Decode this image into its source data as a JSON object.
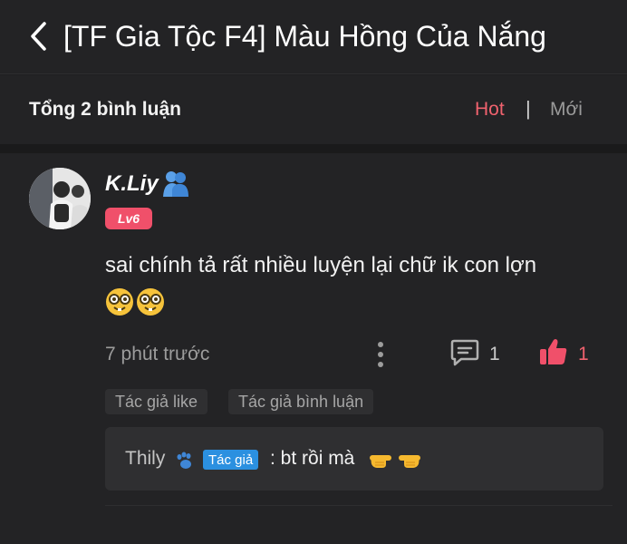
{
  "header": {
    "title": "[TF Gia Tộc F4] Màu Hồng Của Nắng",
    "back_icon": "chevron-left-icon"
  },
  "comments_bar": {
    "count_label": "Tổng 2 bình luận",
    "sort_hot": "Hot",
    "separator": "|",
    "sort_new": "Mới",
    "active_color": "#f0626e"
  },
  "comment": {
    "username": "K.Liy",
    "user_emoji": "people-hugging-icon",
    "level": "Lv6",
    "text": "sai chính tả rất nhiều luyện lại chữ ik con lợn",
    "emojis": [
      "nerd-face-icon",
      "nerd-face-icon"
    ],
    "time": "7 phút trước",
    "reply_count": "1",
    "like_count": "1",
    "tags": [
      "Tác giả like",
      "Tác giả bình luận"
    ],
    "reply": {
      "author": "Thily",
      "author_icon": "paw-icon",
      "badge": "Tác giả",
      "text": ": bt rồi mà",
      "emojis": [
        "backhand-index-pointing-right-icon",
        "backhand-index-pointing-left-icon"
      ]
    }
  },
  "colors": {
    "background": "#232325",
    "accent": "#f0626e",
    "level_badge": "#f0506a",
    "author_badge": "#2b90e0"
  }
}
